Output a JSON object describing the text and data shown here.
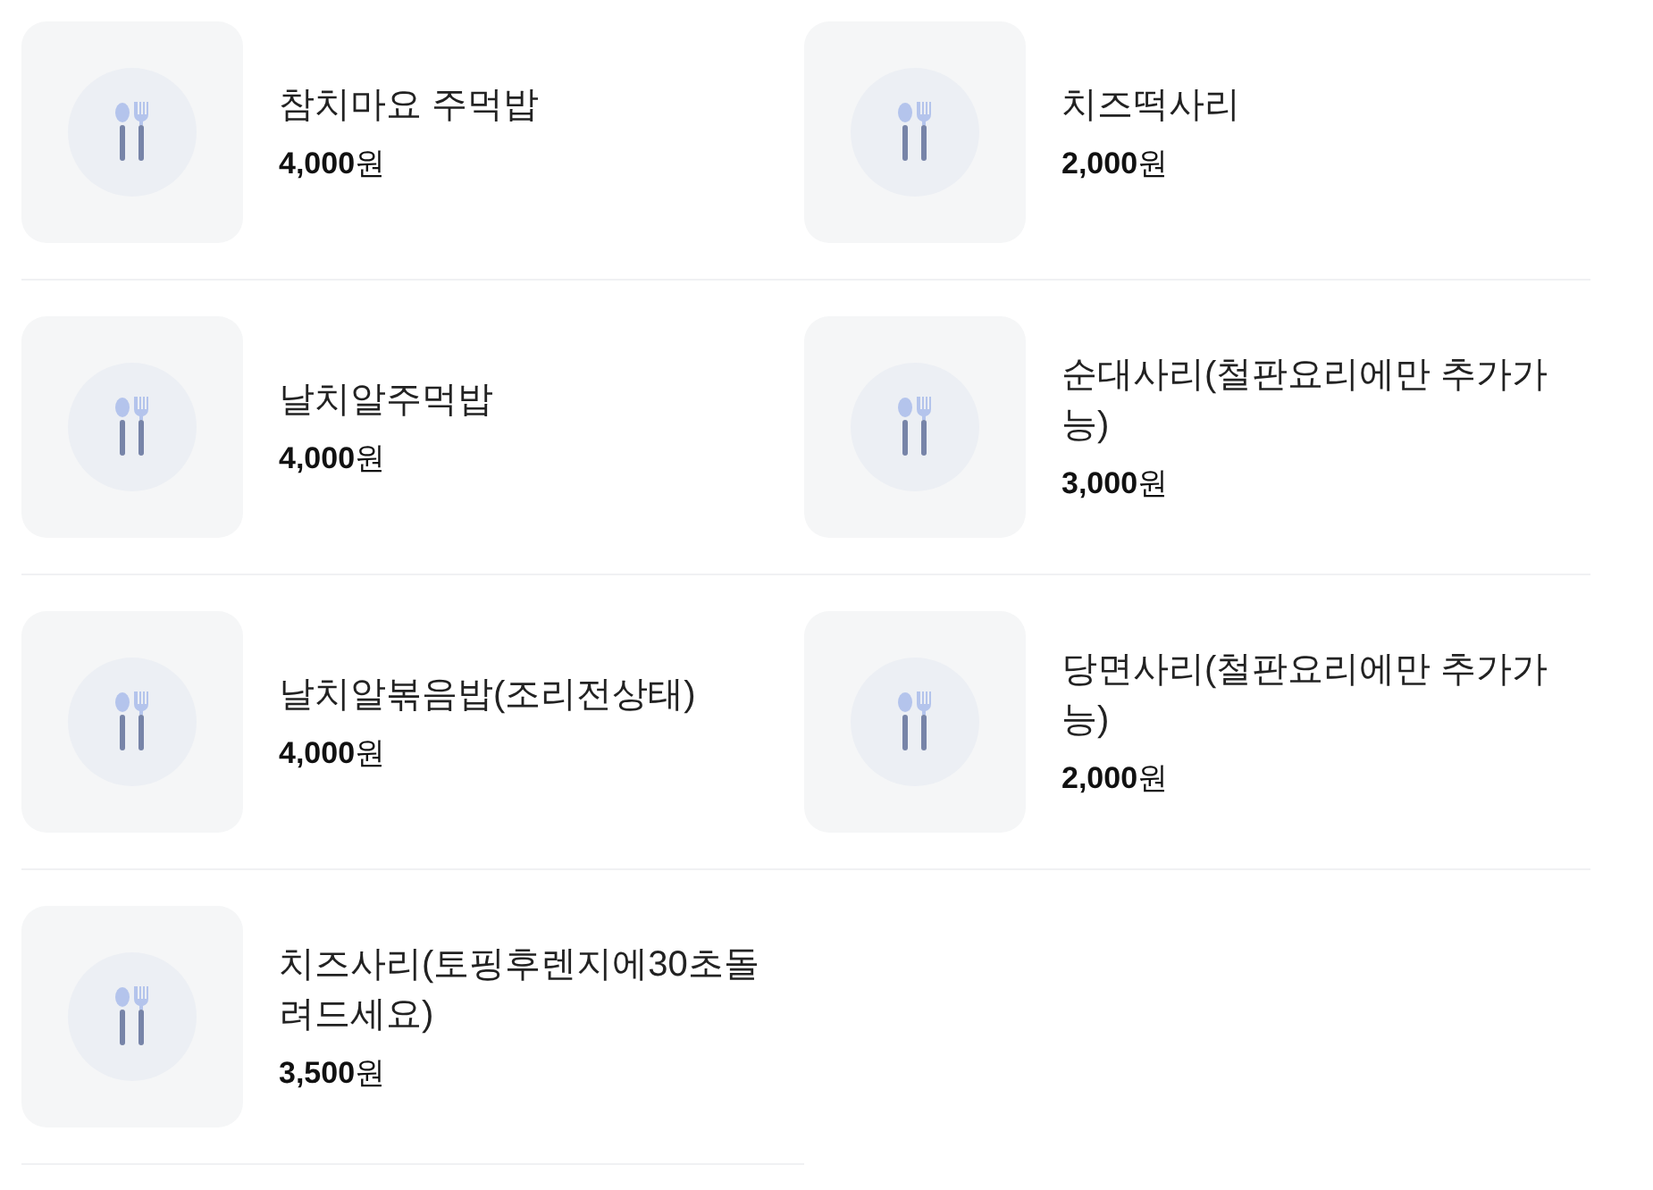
{
  "menu_items": [
    {
      "name": "참치마요 주먹밥",
      "price": "**4,000**원",
      "kind": "picture"
    },
    {
      "name": "날치알주먹밥",
      "price": "**4,000**원",
      "kind": "picture"
    },
    {
      "name": "날치알볶음밥(조리전상태)",
      "price": "**4,000**원",
      "kind": "picture"
    },
    {
      "name": "치즈사리(토핑후렌지에30초돌려드세요)",
      "price": "**3,500**원",
      "kind": "picture"
    },
    {
      "name": "치즈떡사리",
      "price": "**2,000**원",
      "kind": "picture"
    },
    {
      "name": "순대사리(철판요리에만 추가가능)",
      "price": "**3,000**원",
      "kind": "picture"
    },
    {
      "name": "당면사리(철판요리에만 추가가능)",
      "price": "**2,000**원",
      "kind": "picture"
    }
  ]
}
